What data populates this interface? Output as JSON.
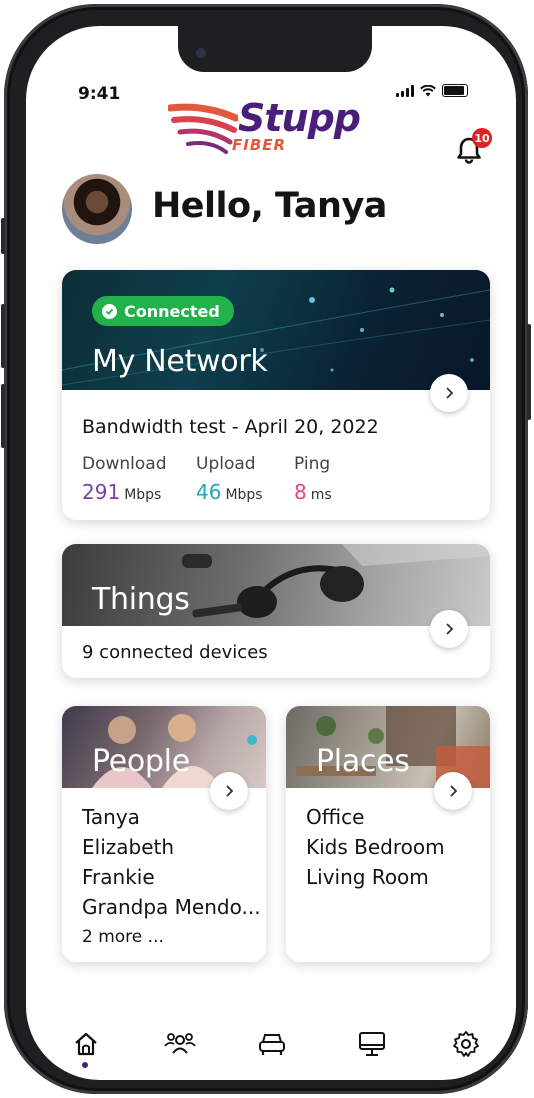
{
  "status_bar": {
    "time": "9:41"
  },
  "brand": {
    "name": "Stupp",
    "sub": "FIBER"
  },
  "notifications": {
    "count": "10"
  },
  "user": {
    "greeting": "Hello, Tanya"
  },
  "network_card": {
    "status": "Connected",
    "title": "My Network",
    "test_title": "Bandwidth test - April 20, 2022",
    "download": {
      "label": "Download",
      "value": "291",
      "unit": "Mbps"
    },
    "upload": {
      "label": "Upload",
      "value": "46",
      "unit": "Mbps"
    },
    "ping": {
      "label": "Ping",
      "value": "8",
      "unit": "ms"
    }
  },
  "things_card": {
    "title": "Things",
    "subtitle": "9 connected devices"
  },
  "people_card": {
    "title": "People",
    "items": [
      "Tanya",
      "Elizabeth",
      "Frankie",
      "Grandpa Mendo..."
    ],
    "more": "2 more ..."
  },
  "places_card": {
    "title": "Places",
    "items": [
      "Office",
      "Kids Bedroom",
      "Living Room"
    ]
  },
  "nav": {
    "items": [
      "home-icon",
      "people-icon",
      "car-icon",
      "monitor-icon",
      "settings-icon"
    ],
    "active": "home-icon"
  },
  "colors": {
    "brand_purple": "#4a1f7a",
    "accent_orange": "#e2583b",
    "connected_green": "#22b24c",
    "download": "#7b3fa6",
    "upload": "#1fa6b8",
    "ping": "#e8457c",
    "badge_red": "#e02222"
  }
}
